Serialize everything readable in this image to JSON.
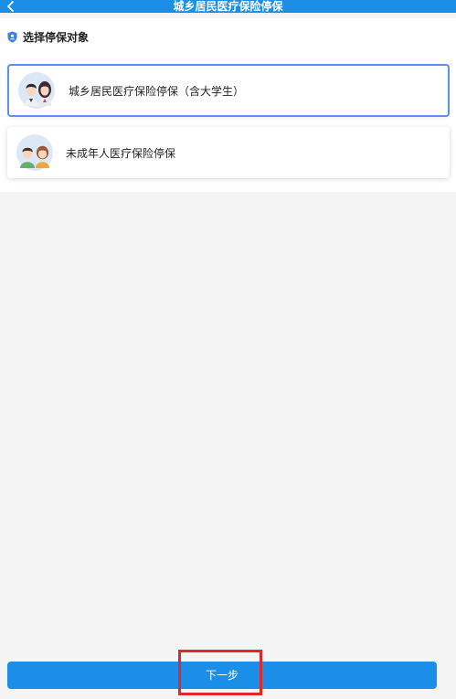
{
  "header": {
    "title": "城乡居民医疗保险停保",
    "back_icon": "chevron-left-icon"
  },
  "section": {
    "title": "选择停保对象",
    "icon": "shield-user-icon"
  },
  "options": [
    {
      "label": "城乡居民医疗保险停保（含大学生）",
      "icon": "adult-couple-avatar-icon",
      "selected": true
    },
    {
      "label": "未成年人医疗保险停保",
      "icon": "children-avatar-icon",
      "selected": false
    }
  ],
  "footer": {
    "next_label": "下一步"
  },
  "colors": {
    "primary": "#1b8fe8",
    "selected_border": "#5b8ff2",
    "highlight": "#e3262b",
    "page_bg": "#f4f4f4"
  }
}
